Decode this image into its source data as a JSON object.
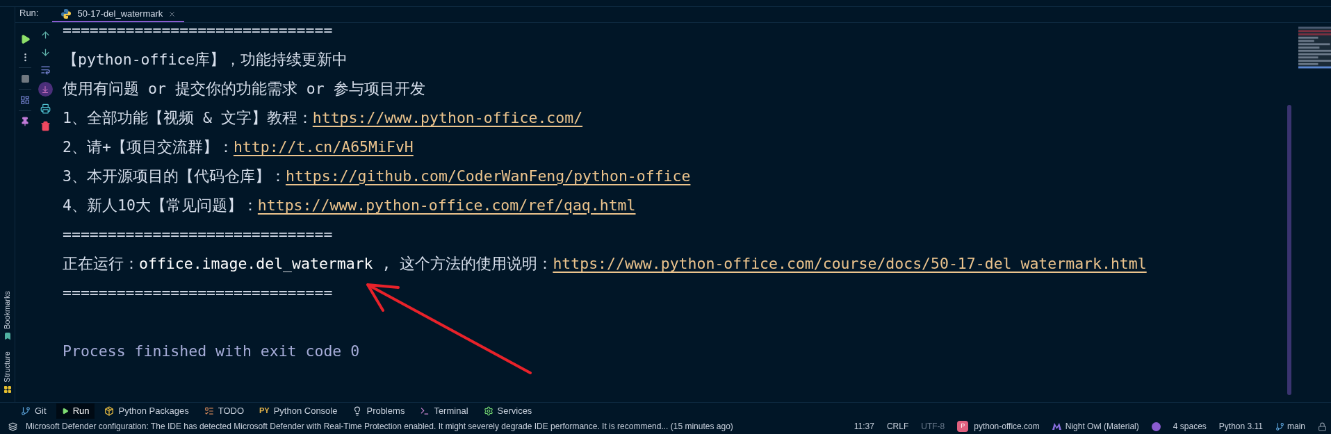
{
  "run_panel": {
    "label": "Run:",
    "tab": {
      "title": "50-17-del_watermark",
      "selected": true
    }
  },
  "console_lines": [
    {
      "kind": "separator",
      "segments": [
        {
          "kind": "plain",
          "text": "=============================="
        }
      ]
    },
    {
      "kind": "text",
      "segments": [
        {
          "kind": "plain",
          "text": "【python-office库】，功能持续更新中"
        }
      ]
    },
    {
      "kind": "text",
      "segments": [
        {
          "kind": "plain",
          "text": "使用有问题 or 提交你的功能需求 or 参与项目开发"
        }
      ]
    },
    {
      "kind": "text",
      "segments": [
        {
          "kind": "plain",
          "text": "1、全部功能【视频 & 文字】教程："
        },
        {
          "kind": "link",
          "text": "https://www.python-office.com/"
        }
      ]
    },
    {
      "kind": "text",
      "segments": [
        {
          "kind": "plain",
          "text": "2、请+【项目交流群】："
        },
        {
          "kind": "link",
          "text": "http://t.cn/A65MiFvH"
        }
      ]
    },
    {
      "kind": "text",
      "segments": [
        {
          "kind": "plain",
          "text": "3、本开源项目的【代码仓库】："
        },
        {
          "kind": "link",
          "text": "https://github.com/CoderWanFeng/python-office"
        }
      ]
    },
    {
      "kind": "text",
      "segments": [
        {
          "kind": "plain",
          "text": "4、新人10大【常见问题】："
        },
        {
          "kind": "link",
          "text": "https://www.python-office.com/ref/qaq.html"
        }
      ]
    },
    {
      "kind": "separator",
      "segments": [
        {
          "kind": "plain",
          "text": "=============================="
        }
      ]
    },
    {
      "kind": "text",
      "segments": [
        {
          "kind": "plain",
          "text": "正在运行："
        },
        {
          "kind": "code",
          "text": "office.image.del_watermark"
        },
        {
          "kind": "plain",
          "text": " , 这个方法的使用说明："
        },
        {
          "kind": "link",
          "text": "https://www.python-office.com/course/docs/50-17-del_watermark.html"
        }
      ]
    },
    {
      "kind": "separator",
      "segments": [
        {
          "kind": "plain",
          "text": "=============================="
        }
      ]
    },
    {
      "kind": "blank"
    },
    {
      "kind": "exit",
      "segments": [
        {
          "kind": "plain",
          "text": "Process finished with exit code 0"
        }
      ]
    }
  ],
  "side_labels": [
    {
      "kind": "bookmarks",
      "text": "Bookmarks"
    },
    {
      "kind": "structure",
      "text": "Structure"
    }
  ],
  "tool_windows": [
    {
      "kind": "branch",
      "label": "Git",
      "selected": false
    },
    {
      "kind": "play",
      "label": "Run",
      "selected": true
    },
    {
      "kind": "package",
      "label": "Python Packages",
      "selected": false
    },
    {
      "kind": "todo",
      "label": "TODO",
      "selected": false
    },
    {
      "kind": "console",
      "icon_text": "PY",
      "label": "Python Console",
      "selected": false
    },
    {
      "kind": "bulb",
      "label": "Problems",
      "selected": false
    },
    {
      "kind": "terminal",
      "label": "Terminal",
      "selected": false
    },
    {
      "kind": "gear",
      "label": "Services",
      "selected": false
    }
  ],
  "status_bar": {
    "message": "Microsoft Defender configuration: The IDE has detected Microsoft Defender with Real-Time Protection enabled. It might severely degrade IDE performance. It is recommend... (15 minutes ago)",
    "items": [
      {
        "kind": "text",
        "text": "11:37"
      },
      {
        "kind": "text",
        "text": "CRLF"
      },
      {
        "kind": "muted",
        "text": "UTF-8"
      },
      {
        "kind": "project",
        "badge": "P",
        "text": "python-office.com"
      },
      {
        "kind": "theme",
        "text": "Night Owl (Material)"
      },
      {
        "kind": "indicator"
      },
      {
        "kind": "text",
        "text": "4 spaces"
      },
      {
        "kind": "text",
        "text": "Python 3.11"
      },
      {
        "kind": "branch",
        "text": "main"
      },
      {
        "kind": "lock"
      }
    ]
  }
}
